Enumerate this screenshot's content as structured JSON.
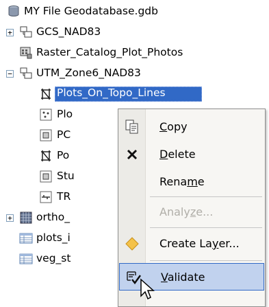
{
  "tree": {
    "root": {
      "label": "MY File Geodatabase.gdb",
      "icon": "database-icon"
    },
    "items": [
      {
        "label": "GCS_NAD83",
        "icon": "feature-dataset-icon",
        "expander": "+"
      },
      {
        "label": "Raster_Catalog_Plot_Photos",
        "icon": "raster-catalog-icon"
      },
      {
        "label": "UTM_Zone6_NAD83",
        "icon": "feature-dataset-icon",
        "expander": "−"
      },
      {
        "label": "Plots_On_Topo_Lines",
        "icon": "topology-icon",
        "selected": true
      },
      {
        "label": "Plo",
        "icon": "point-feature-class-icon"
      },
      {
        "label": "PC",
        "icon": "polygon-feature-class-icon"
      },
      {
        "label": "Po",
        "icon": "topology-icon"
      },
      {
        "label": "Stu",
        "icon": "polygon-feature-class-icon"
      },
      {
        "label": "TR",
        "icon": "line-feature-class-icon"
      },
      {
        "label": "ortho_",
        "icon": "raster-dataset-icon",
        "expander": "+"
      },
      {
        "label": "plots_i",
        "icon": "table-icon"
      },
      {
        "label": "veg_st",
        "icon": "table-icon"
      }
    ]
  },
  "context_menu": {
    "items": [
      {
        "label": "Copy",
        "mnemonic_index": 0,
        "icon": "copy-icon",
        "disabled": false
      },
      {
        "label": "Delete",
        "mnemonic_index": 0,
        "icon": "delete-x-icon",
        "disabled": false
      },
      {
        "label": "Rename",
        "mnemonic_index": 4,
        "icon": "",
        "disabled": false
      },
      {
        "label": "Analyze...",
        "mnemonic_index": 5,
        "icon": "",
        "disabled": true
      },
      {
        "label": "Create Layer...",
        "mnemonic_index": 9,
        "icon": "create-layer-icon",
        "disabled": false
      },
      {
        "label": "Validate",
        "mnemonic_index": 0,
        "icon": "validate-icon",
        "disabled": false,
        "hover": true
      }
    ]
  },
  "colors": {
    "selection": "#3169c6",
    "menu_hover": "#c1d2ee",
    "menu_background": "#f7f6f3"
  }
}
